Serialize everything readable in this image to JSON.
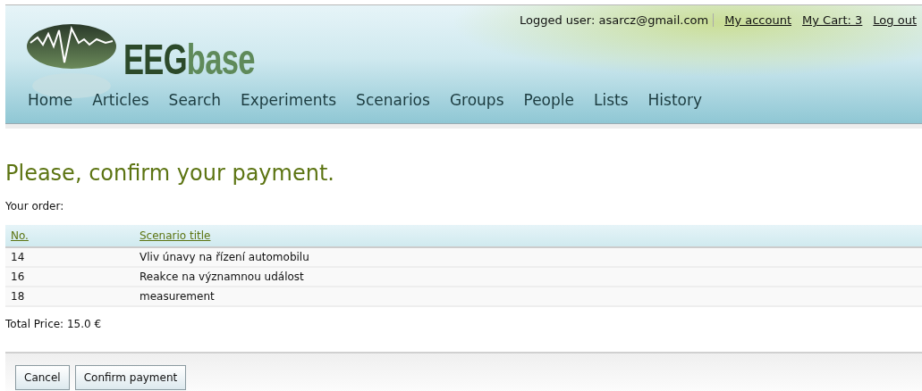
{
  "header": {
    "logo": {
      "dark": "EEG",
      "light": "base"
    },
    "logged_user": "Logged user: asarcz@gmail.com",
    "links": [
      "My account",
      "My Cart: 3",
      "Log out"
    ]
  },
  "nav": [
    "Home",
    "Articles",
    "Search",
    "Experiments",
    "Scenarios",
    "Groups",
    "People",
    "Lists",
    "History"
  ],
  "heading": "Please, confirm your payment.",
  "order_label": "Your order:",
  "table": {
    "columns": [
      "No.",
      "Scenario title"
    ],
    "rows": [
      [
        "14",
        "Vliv únavy na řízení automobilu"
      ],
      [
        "16",
        "Reakce na významnou událost"
      ],
      [
        "18",
        "measurement"
      ]
    ]
  },
  "total": "Total Price: 15.0 €",
  "buttons": [
    "Cancel",
    "Confirm payment"
  ]
}
